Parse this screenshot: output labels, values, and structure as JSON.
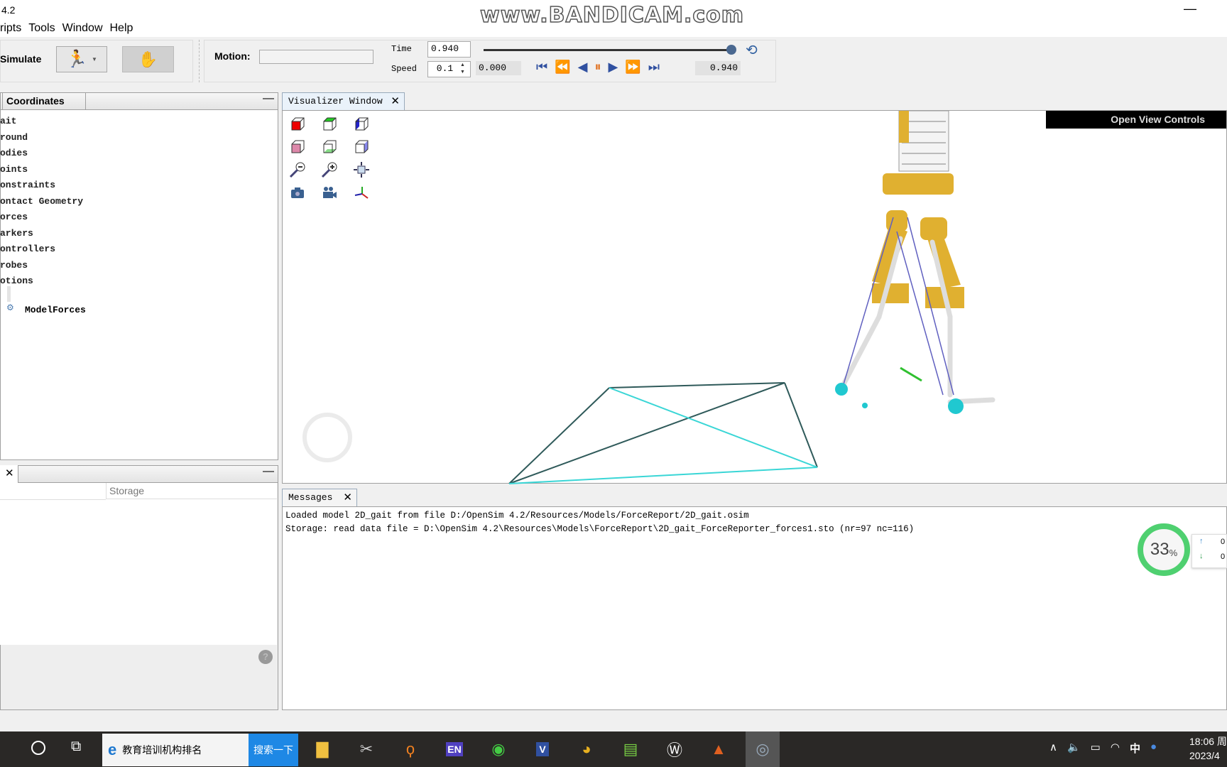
{
  "window": {
    "title": "4.2",
    "menu": [
      "ripts",
      "Tools",
      "Window",
      "Help"
    ],
    "watermark": "www.BANDICAM.com"
  },
  "toolbar": {
    "simulate_label": "Simulate",
    "motion_label": "Motion:",
    "motion_value": "",
    "time_label": "Time",
    "time_value": "0.940",
    "speed_label": "Speed",
    "speed_value": "0.1",
    "start_time": "0.000",
    "end_time": "0.940",
    "slider_fraction": 1.0
  },
  "navigator": {
    "tab": "Coordinates",
    "items": [
      "ait",
      "round",
      "odies",
      "oints",
      "onstraints",
      "ontact Geometry",
      "orces",
      "arkers",
      "ontrollers",
      "robes",
      "otions"
    ],
    "model_forces": "ModelForces"
  },
  "properties": {
    "column": "Storage"
  },
  "visualizer": {
    "tab": "Visualizer Window",
    "open_view_controls": "Open View Controls",
    "toolbar_icons": [
      "front-view-icon",
      "top-view-icon",
      "right-view-icon",
      "back-view-icon",
      "bottom-view-icon",
      "left-view-icon",
      "zoom-out-icon",
      "zoom-in-icon",
      "fit-view-icon",
      "snapshot-icon",
      "record-icon",
      "axes-icon"
    ]
  },
  "messages": {
    "tab": "Messages",
    "lines": [
      "Loaded model 2D_gait from file D:/OpenSim 4.2/Resources/Models/ForceReport/2D_gait.osim",
      "Storage: read data file = D:\\OpenSim 4.2\\Resources\\Models\\ForceReport\\2D_gait_ForceReporter_forces1.sto (nr=97 nc=116)"
    ]
  },
  "overlay": {
    "percent": "33",
    "unit": "%",
    "up": "0",
    "down": "0"
  },
  "taskbar": {
    "search_text": "教育培训机构排名",
    "search_button": "搜索一下",
    "time": "18:06 周",
    "date": "2023/4",
    "ime": "中"
  },
  "colors": {
    "accent": "#1e88e5",
    "ground_dark": "#2f5a5a",
    "ground_cyan": "#3ad6d6",
    "exo": "#e0b030"
  }
}
